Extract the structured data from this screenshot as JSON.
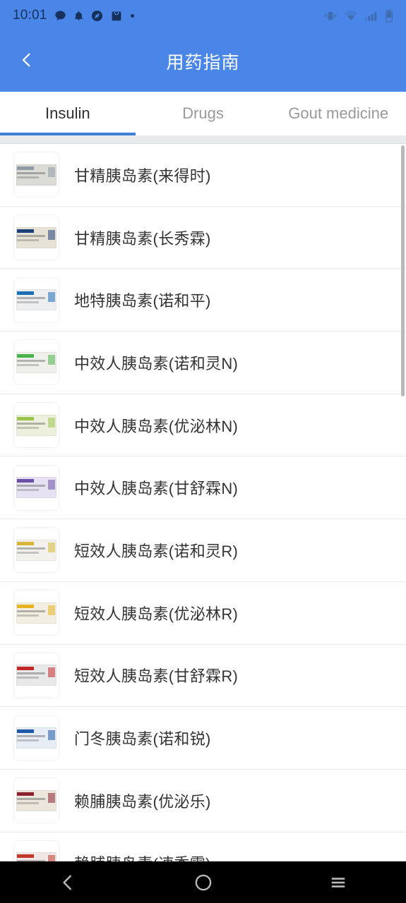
{
  "status_bar": {
    "time": "10:01",
    "left_icons": [
      "chat-bubble-icon",
      "bell-icon",
      "compass-icon",
      "shopping-bag-icon",
      "dot-icon"
    ],
    "right_icons": [
      "vibrate-icon",
      "wifi-icon",
      "signal-icon",
      "battery-icon"
    ]
  },
  "app_bar": {
    "title": "用药指南",
    "back_icon": "chevron-left-icon",
    "background_color": "#4A86E8",
    "title_color": "#FFFFFF"
  },
  "tabs": {
    "active_index": 0,
    "indicator_color": "#3F7FD6",
    "active_color": "#2F2F2F",
    "inactive_color": "#9A9A9A",
    "items": [
      {
        "label": "Insulin"
      },
      {
        "label": "Drugs"
      },
      {
        "label": "Gout medicine"
      }
    ]
  },
  "list": {
    "items": [
      {
        "label": "甘精胰岛素(来得时)",
        "thumb_tone": "#dcdcd6",
        "thumb_accent": "#8f9aa6"
      },
      {
        "label": "甘精胰岛素(长秀霖)",
        "thumb_tone": "#e6e3d6",
        "thumb_accent": "#1c3f7a"
      },
      {
        "label": "地特胰岛素(诺和平)",
        "thumb_tone": "#eceef0",
        "thumb_accent": "#1a6fb5"
      },
      {
        "label": "中效人胰岛素(诺和灵N)",
        "thumb_tone": "#f0f0ea",
        "thumb_accent": "#49b24a"
      },
      {
        "label": "中效人胰岛素(优泌林N)",
        "thumb_tone": "#eef0de",
        "thumb_accent": "#9cc34a"
      },
      {
        "label": "中效人胰岛素(甘舒霖N)",
        "thumb_tone": "#e7e2f2",
        "thumb_accent": "#6b4fa8"
      },
      {
        "label": "短效人胰岛素(诺和灵R)",
        "thumb_tone": "#f2f1ec",
        "thumb_accent": "#d8b63a"
      },
      {
        "label": "短效人胰岛素(优泌林R)",
        "thumb_tone": "#f2efe2",
        "thumb_accent": "#e8b322"
      },
      {
        "label": "短效人胰岛素(甘舒霖R)",
        "thumb_tone": "#e9e9e9",
        "thumb_accent": "#c22a2a"
      },
      {
        "label": "门冬胰岛素(诺和锐)",
        "thumb_tone": "#e6edf5",
        "thumb_accent": "#1f58a6"
      },
      {
        "label": "赖脯胰岛素(优泌乐)",
        "thumb_tone": "#ece6dd",
        "thumb_accent": "#8b2230"
      },
      {
        "label": "赖脯胰岛素(速秀霖)",
        "thumb_tone": "#f0e6e6",
        "thumb_accent": "#c0392b"
      }
    ]
  },
  "nav_bar": {
    "buttons": [
      {
        "name": "back",
        "icon": "chevron-left-icon"
      },
      {
        "name": "home",
        "icon": "circle-icon"
      },
      {
        "name": "recents",
        "icon": "menu-icon"
      }
    ]
  }
}
